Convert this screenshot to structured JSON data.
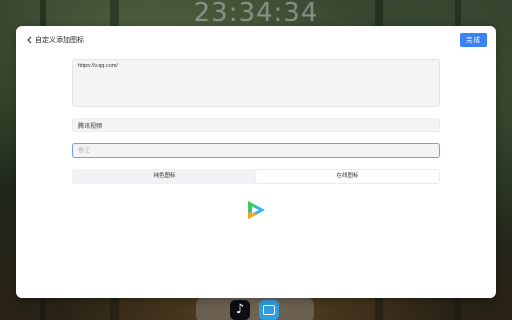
{
  "lockscreen": {
    "clock": "23:34:34"
  },
  "dialog": {
    "back_icon": "chevron-left-icon",
    "title": "自定义添加图标",
    "done_label": "完成",
    "url_value": "https://v.qq.com/",
    "name_value": "腾讯视频",
    "remark_placeholder": "备注",
    "tabs": [
      {
        "label": "纯色图标",
        "active": false
      },
      {
        "label": "在线图标",
        "active": true
      }
    ],
    "preview_icon": "tencent-video-icon"
  },
  "dock": {
    "apps": [
      {
        "icon": "tiktok-icon"
      },
      {
        "icon": "bilibili-icon"
      }
    ]
  },
  "colors": {
    "accent": "#3b82f6",
    "focus_border": "#6aa0f7"
  }
}
